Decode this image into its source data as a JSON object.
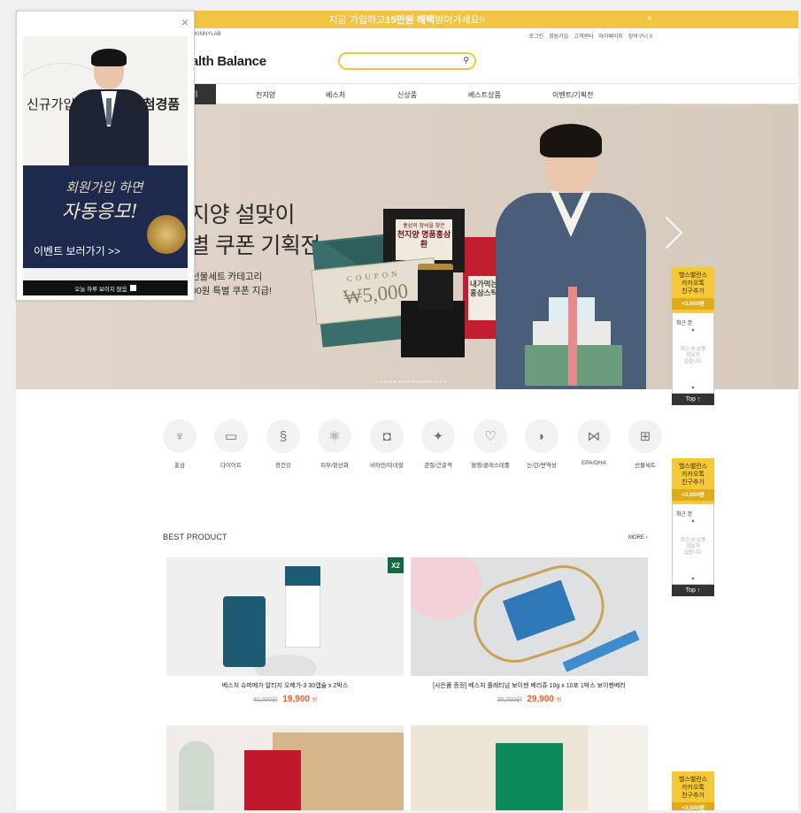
{
  "top_banner": {
    "text_before": "지금 가입하고 ",
    "text_highlight": "15만원 혜택",
    "text_after": "받아가세요! ",
    "arrow": "›",
    "close": "×"
  },
  "util": {
    "brand_mini": "SKINNYLAB",
    "links": [
      "로그인",
      "회원가입",
      "고객센터",
      "마이페이지",
      "장바구니 0"
    ]
  },
  "header": {
    "logo": "alth Balance",
    "search_icon": "search-icon"
  },
  "gnb": {
    "all_label": "기",
    "items": [
      "천지양",
      "베스처",
      "신상품",
      "베스트상품",
      "이벤트/기획전"
    ]
  },
  "hero": {
    "title_line1": "지양 설맞이",
    "title_line2": "별 쿠폰 기획전",
    "sub_line1": "선물세트 카테고리",
    "sub_line2": "00원 특별 쿠폰 지급!",
    "coupon_word": "COUPON",
    "coupon_value": "₩5,000",
    "box_brand": "홍삼의 정석을 찾은",
    "box_name": "천지양 명품홍삼환",
    "red_box": "내가먹는 홍삼스틱"
  },
  "categories": [
    {
      "label": "홍삼",
      "icon": "ginseng-icon"
    },
    {
      "label": "다이어트",
      "icon": "tape-measure-icon"
    },
    {
      "label": "장건강",
      "icon": "intestine-icon"
    },
    {
      "label": "피부/항산화",
      "icon": "atom-icon"
    },
    {
      "label": "비타민/미네랄",
      "icon": "vitamin-jar-icon"
    },
    {
      "label": "관절/근골격",
      "icon": "joint-icon"
    },
    {
      "label": "혈행/콜레스테롤",
      "icon": "heartbeat-icon"
    },
    {
      "label": "눈/간/면역성",
      "icon": "liver-icon"
    },
    {
      "label": "EPA/DHA",
      "icon": "fish-icon"
    },
    {
      "label": "선물세트",
      "icon": "gift-icon"
    }
  ],
  "best": {
    "title": "BEST PRODUCT",
    "more": "MORE",
    "products": [
      {
        "name": "베스처 슈퍼메가 알티지 오메가-3 30캡슐 x 2박스",
        "old_price": "40,000원",
        "price": "19,900",
        "won": "원",
        "badge": "X2"
      },
      {
        "name": "[사은품 증정] 베스처 플래티넘 보이젠 베리쥬 10g x 10포 1박스 보이젠베리",
        "old_price": "35,000원",
        "price": "29,900",
        "won": "원"
      }
    ]
  },
  "quick": {
    "kakao_line1": "헬스밸런스",
    "kakao_line2": "카카오톡",
    "kakao_line3": "친구추가",
    "points": "+3,000원",
    "recent_title": "최근 본",
    "recent_empty1": "최근 본 상품",
    "recent_empty2": "정보가",
    "recent_empty3": "없습니다",
    "top": "Top ↑"
  },
  "popup": {
    "close": "×",
    "signup": "신규가입",
    "lucky": "추첨경품",
    "hand1": "회원가입 하면",
    "hand2": "자동응모!",
    "event_link": "이벤트 보러가기 >>",
    "dont_show": "오늘 하루 보이지 않음"
  },
  "colors": {
    "accent_yellow": "#f2c443",
    "price_orange": "#e95c22",
    "navy": "#1d2a4e"
  }
}
